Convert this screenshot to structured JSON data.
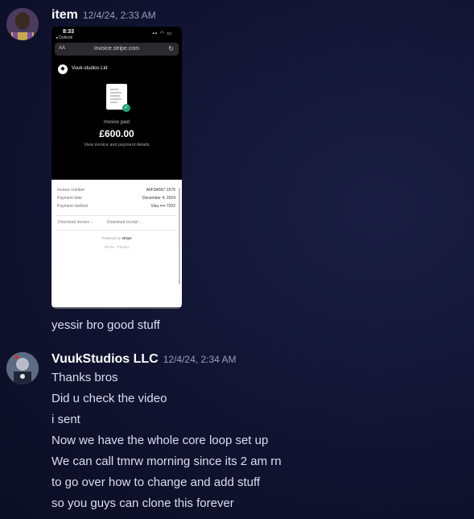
{
  "message1": {
    "username": "item",
    "timestamp": "12/4/24, 2:33 AM",
    "attachment": {
      "status_time": "8:33",
      "status_back": "◂ Outlook",
      "url": "invoice.stripe.com",
      "url_prefix": "AA",
      "merchant": "Vuuk-studios Ltd",
      "paid_label": "Invoice paid",
      "amount": "£600.00",
      "view_link": "View invoice and payment details",
      "rows": [
        {
          "label": "Invoice number",
          "value": "A0F3A567-1576"
        },
        {
          "label": "Payment date",
          "value": "December 4, 2024"
        },
        {
          "label": "Payment method",
          "value": "Visa •••• 7202"
        }
      ],
      "download_invoice": "Download invoice",
      "download_receipt": "Download receipt",
      "powered_by": "Powered by",
      "powered_brand": "stripe",
      "terms": "Terms",
      "privacy": "Privacy"
    },
    "text": "yessir bro good stuff"
  },
  "message2": {
    "username": "VuukStudios LLC",
    "timestamp": "12/4/24, 2:34 AM",
    "lines": [
      "Thanks bros",
      "Did u check the video",
      "i sent",
      "Now we have the whole core loop set up",
      "We can call tmrw morning since its 2 am rn",
      "to go over how to change and add stuff",
      "so you guys can clone this forever"
    ]
  }
}
